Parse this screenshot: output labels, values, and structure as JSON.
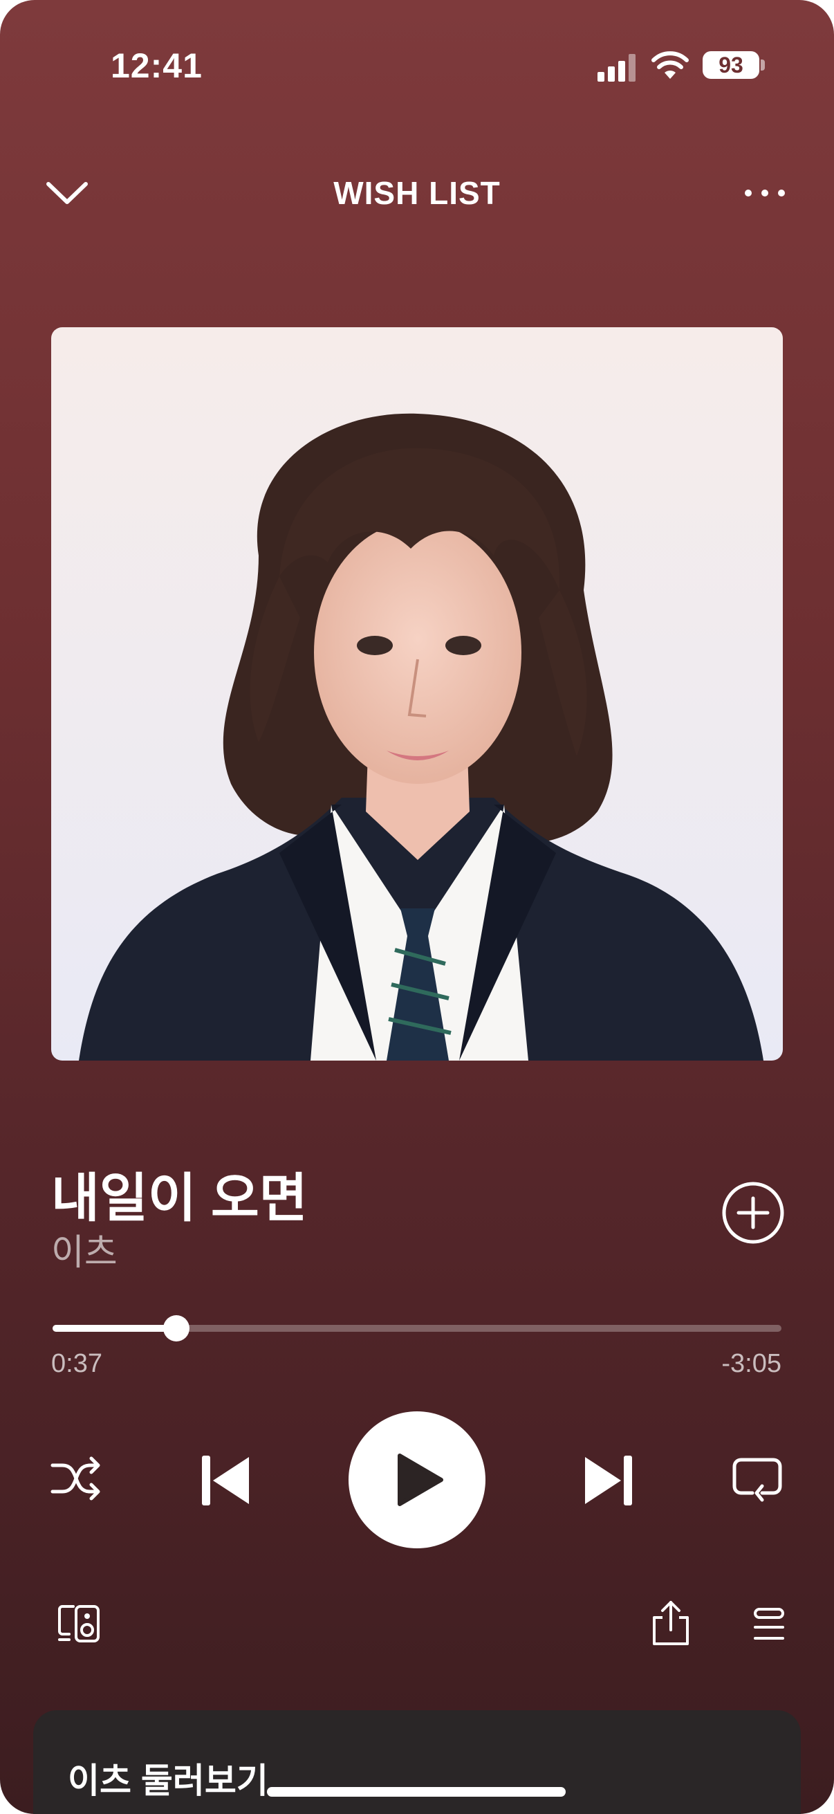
{
  "status_bar": {
    "time": "12:41",
    "battery": "93",
    "icons": [
      "signal-icon",
      "wifi-icon",
      "battery-icon"
    ]
  },
  "header": {
    "title": "WISH LIST",
    "left_icon": "chevron-down-icon",
    "right_icon": "more-dots-icon"
  },
  "artwork": {
    "kind": "album-art-portrait"
  },
  "song": {
    "title": "내일이 오면",
    "artist": "이츠",
    "add_icon": "add-circle-icon"
  },
  "progress": {
    "elapsed": "0:37",
    "remaining": "-3:05",
    "fraction": 0.17
  },
  "controls": {
    "shuffle_icon": "shuffle-icon",
    "previous_icon": "previous-icon",
    "play_icon": "play-icon",
    "next_icon": "next-icon",
    "repeat_icon": "repeat-icon"
  },
  "bottom_bar": {
    "devices_icon": "connect-device-icon",
    "share_icon": "share-icon",
    "queue_icon": "queue-icon"
  },
  "artist_card": {
    "title": "이츠 둘러보기"
  },
  "colors": {
    "background_top": "#7e3a3c",
    "background_bottom": "#3c1d20",
    "accent": "#ffffff",
    "card": "#2a2627"
  }
}
